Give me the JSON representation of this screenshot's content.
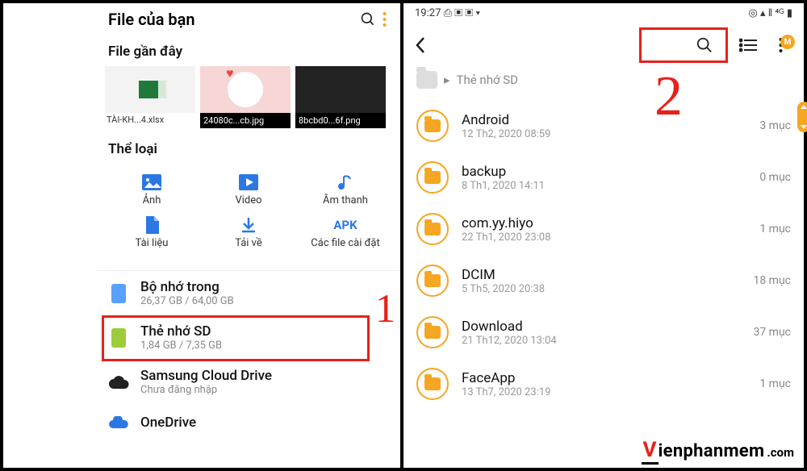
{
  "left": {
    "header_title": "File của bạn",
    "section_recent": "File gần đây",
    "recent_files": [
      {
        "name": "TÀI-KH...4.xlsx"
      },
      {
        "name": "24080c...cb.jpg"
      },
      {
        "name": "8bcbd0...6f.png"
      }
    ],
    "section_categories": "Thể loại",
    "categories": {
      "image": "Ảnh",
      "video": "Video",
      "audio": "Âm thanh",
      "document": "Tài liệu",
      "download": "Tải về",
      "apk": "Các file cài đặt",
      "apk_label": "APK"
    },
    "storage": {
      "internal": {
        "title": "Bộ nhớ trong",
        "sub": "26,37 GB / 64,00 GB"
      },
      "sd": {
        "title": "Thẻ nhớ SD",
        "sub": "1,84 GB / 7,35 GB"
      },
      "cloud": {
        "title": "Samsung Cloud Drive",
        "sub": "Chưa đăng nhập"
      },
      "onedrive": {
        "title": "OneDrive"
      }
    },
    "annotation": "1"
  },
  "right": {
    "status": {
      "time": "19:27",
      "left_icons": "⎙ ▣ ▣ ▾",
      "right_icons": "◎ ▴ ‖ ⁴ᴳ ▮"
    },
    "breadcrumb": "Thẻ nhớ SD",
    "badge": "M",
    "annotation": "2",
    "folders": [
      {
        "name": "Android",
        "date": "12 Th2, 2020 08:59",
        "count": "3 mục"
      },
      {
        "name": "backup",
        "date": "8 Th1, 2020 14:11",
        "count": "0 mục"
      },
      {
        "name": "com.yy.hiyo",
        "date": "22 Th1, 2020 23:08",
        "count": "1 mục"
      },
      {
        "name": "DCIM",
        "date": "5 Th5, 2020 20:38",
        "count": "18 mục"
      },
      {
        "name": "Download",
        "date": "21 Th12, 2020 13:04",
        "count": "37 mục"
      },
      {
        "name": "FaceApp",
        "date": "13 Th7, 2020 23:19",
        "count": "1 mục"
      }
    ]
  },
  "watermark": {
    "v": "V",
    "rest": "ienphanmem",
    "com": ".com"
  }
}
